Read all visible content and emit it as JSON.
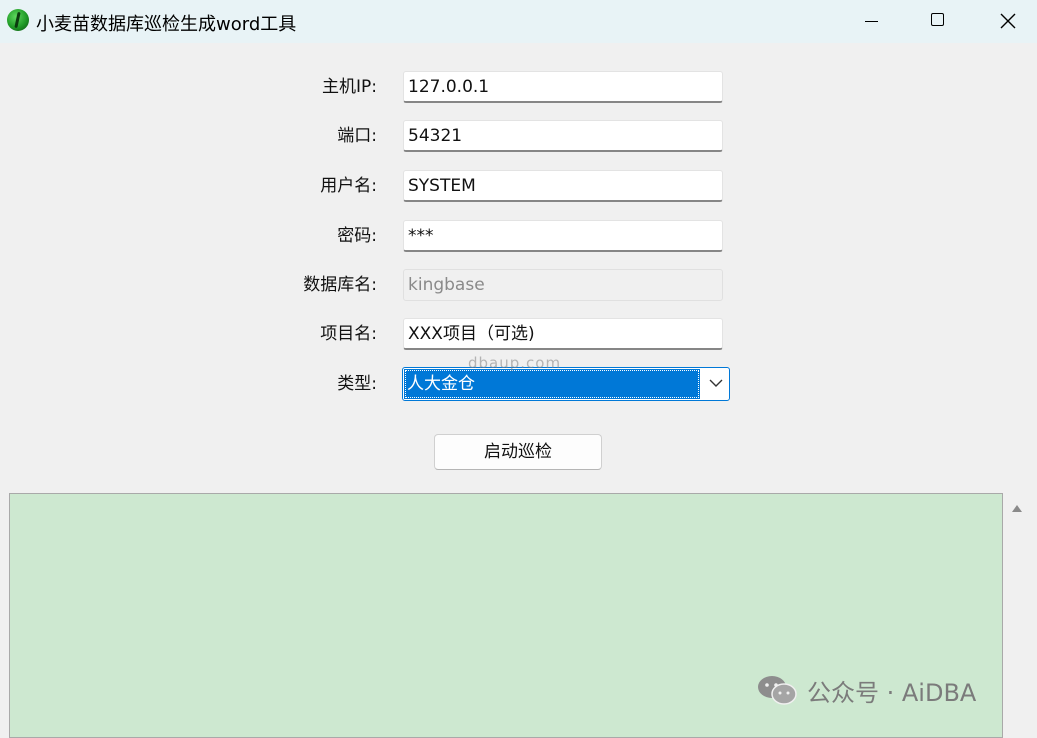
{
  "window": {
    "title": "小麦苗数据库巡检生成word工具"
  },
  "form": {
    "host_label": "主机IP:",
    "host_value": "127.0.0.1",
    "port_label": "端口:",
    "port_value": "54321",
    "user_label": "用户名:",
    "user_value": "SYSTEM",
    "password_label": "密码:",
    "password_value": "***",
    "dbname_label": "数据库名:",
    "dbname_value": "kingbase",
    "project_label": "项目名:",
    "project_value": "XXX项目（可选)",
    "type_label": "类型:",
    "type_value": "人大金仓"
  },
  "actions": {
    "start_label": "启动巡检"
  },
  "watermarks": {
    "site": "dbaup.com",
    "brand": "公众号 · AiDBA"
  },
  "icons": {
    "app": "wheat-seedling-icon",
    "minimize": "minimize-icon",
    "maximize": "maximize-icon",
    "close": "close-icon",
    "dropdown": "chevron-down-icon",
    "scroll_up": "scroll-up-arrow-icon",
    "brand": "wechat-icon"
  },
  "colors": {
    "title_bar": "#e8f3f6",
    "selection": "#0078d7",
    "log_background": "#cde8d0"
  }
}
